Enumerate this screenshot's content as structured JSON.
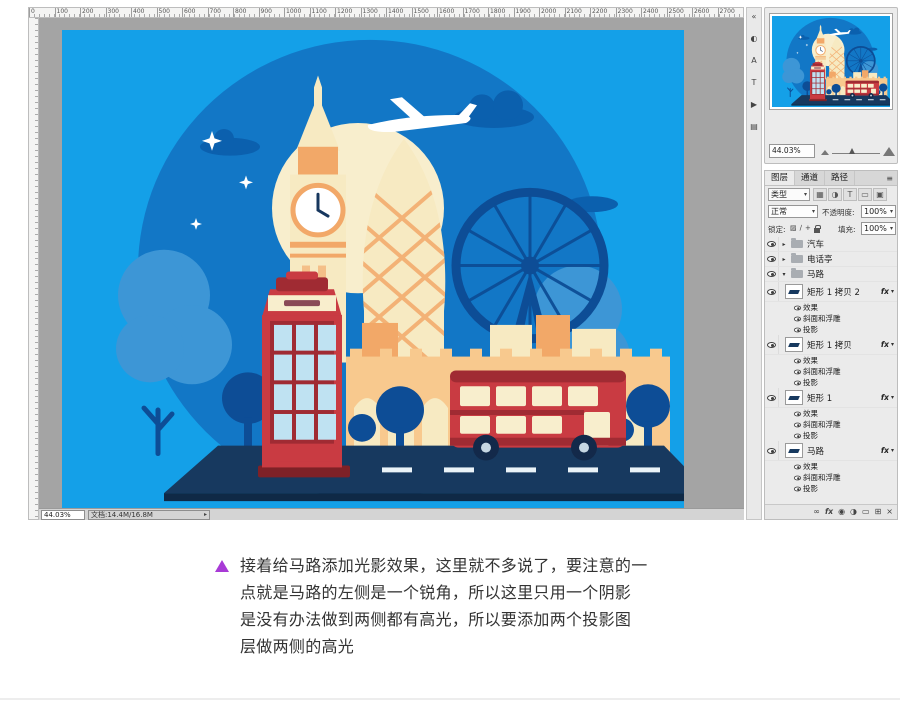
{
  "ruler": {
    "h_values": [
      "0",
      "100",
      "200",
      "300",
      "400",
      "500",
      "600",
      "700",
      "800",
      "900",
      "1000",
      "1100",
      "1200",
      "1300",
      "1400",
      "1500",
      "1600",
      "1700",
      "1800",
      "1900",
      "2000",
      "2100",
      "2200",
      "2300",
      "2400",
      "2500",
      "2600",
      "2700"
    ]
  },
  "statusbar": {
    "zoom": "44.03%",
    "doc_info": "文档:14.4M/16.8M"
  },
  "dock_icons": [
    {
      "name": "collapse-panels-icon",
      "glyph": "«"
    },
    {
      "name": "color-panel-icon",
      "glyph": "◐"
    },
    {
      "name": "character-panel-icon",
      "glyph": "A"
    },
    {
      "name": "paragraph-panel-icon",
      "glyph": "T"
    },
    {
      "name": "actions-panel-icon",
      "glyph": "▶"
    },
    {
      "name": "histogram-panel-icon",
      "glyph": "▤"
    }
  ],
  "navigator": {
    "zoom": "44.03%"
  },
  "layers_panel": {
    "tabs": [
      {
        "label": "图层"
      },
      {
        "label": "通道"
      },
      {
        "label": "路径"
      }
    ],
    "filter_label": "类型",
    "filter_icons": [
      {
        "name": "filter-pixel-layers-icon",
        "glyph": "▦"
      },
      {
        "name": "filter-adjustment-layers-icon",
        "glyph": "◑"
      },
      {
        "name": "filter-type-layers-icon",
        "glyph": "T"
      },
      {
        "name": "filter-shape-layers-icon",
        "glyph": "▭"
      },
      {
        "name": "filter-smart-objects-icon",
        "glyph": "▣"
      }
    ],
    "blend_mode": "正常",
    "opacity_label": "不透明度:",
    "opacity_value": "100%",
    "lock_label": "锁定:",
    "fill_label": "填充:",
    "fill_value": "100%",
    "items": [
      {
        "type": "group",
        "name": "汽车",
        "expanded": false
      },
      {
        "type": "group",
        "name": "电话亭",
        "expanded": false
      },
      {
        "type": "group",
        "name": "马路",
        "expanded": true
      },
      {
        "type": "layer",
        "name": "矩形 1 拷贝 2",
        "fx": true
      },
      {
        "type": "effect",
        "name": "效果"
      },
      {
        "type": "effect",
        "name": "斜面和浮雕"
      },
      {
        "type": "effect",
        "name": "投影"
      },
      {
        "type": "layer",
        "name": "矩形 1 拷贝",
        "fx": true
      },
      {
        "type": "effect",
        "name": "效果"
      },
      {
        "type": "effect",
        "name": "斜面和浮雕"
      },
      {
        "type": "effect",
        "name": "投影"
      },
      {
        "type": "layer",
        "name": "矩形 1",
        "fx": true
      },
      {
        "type": "effect",
        "name": "效果"
      },
      {
        "type": "effect",
        "name": "斜面和浮雕"
      },
      {
        "type": "effect",
        "name": "投影"
      },
      {
        "type": "layer",
        "name": "马路",
        "fx": true
      },
      {
        "type": "effect",
        "name": "效果"
      },
      {
        "type": "effect",
        "name": "斜面和浮雕"
      },
      {
        "type": "effect",
        "name": "投影"
      }
    ],
    "bottom_icons": [
      {
        "name": "link-layers-icon",
        "glyph": "∞"
      },
      {
        "name": "layer-style-icon",
        "glyph": "fx"
      },
      {
        "name": "layer-mask-icon",
        "glyph": "◉"
      },
      {
        "name": "adjustment-layer-icon",
        "glyph": "◑"
      },
      {
        "name": "new-group-icon",
        "glyph": "▭"
      },
      {
        "name": "new-layer-icon",
        "glyph": "⊞"
      },
      {
        "name": "delete-layer-icon",
        "glyph": "×"
      }
    ]
  },
  "caption": {
    "text": "接着给马路添加光影效果，这里就不多说了，要注意的一\n点就是马路的左侧是一个锐角，所以这里只用一个阴影\n是没有办法做到两侧都有高光，所以要添加两个投影图\n层做两侧的高光"
  },
  "colors": {
    "accent_purple": "#A83AD6",
    "canvas_blue": "#14A0E8",
    "circle_blue": "#1277C6"
  }
}
